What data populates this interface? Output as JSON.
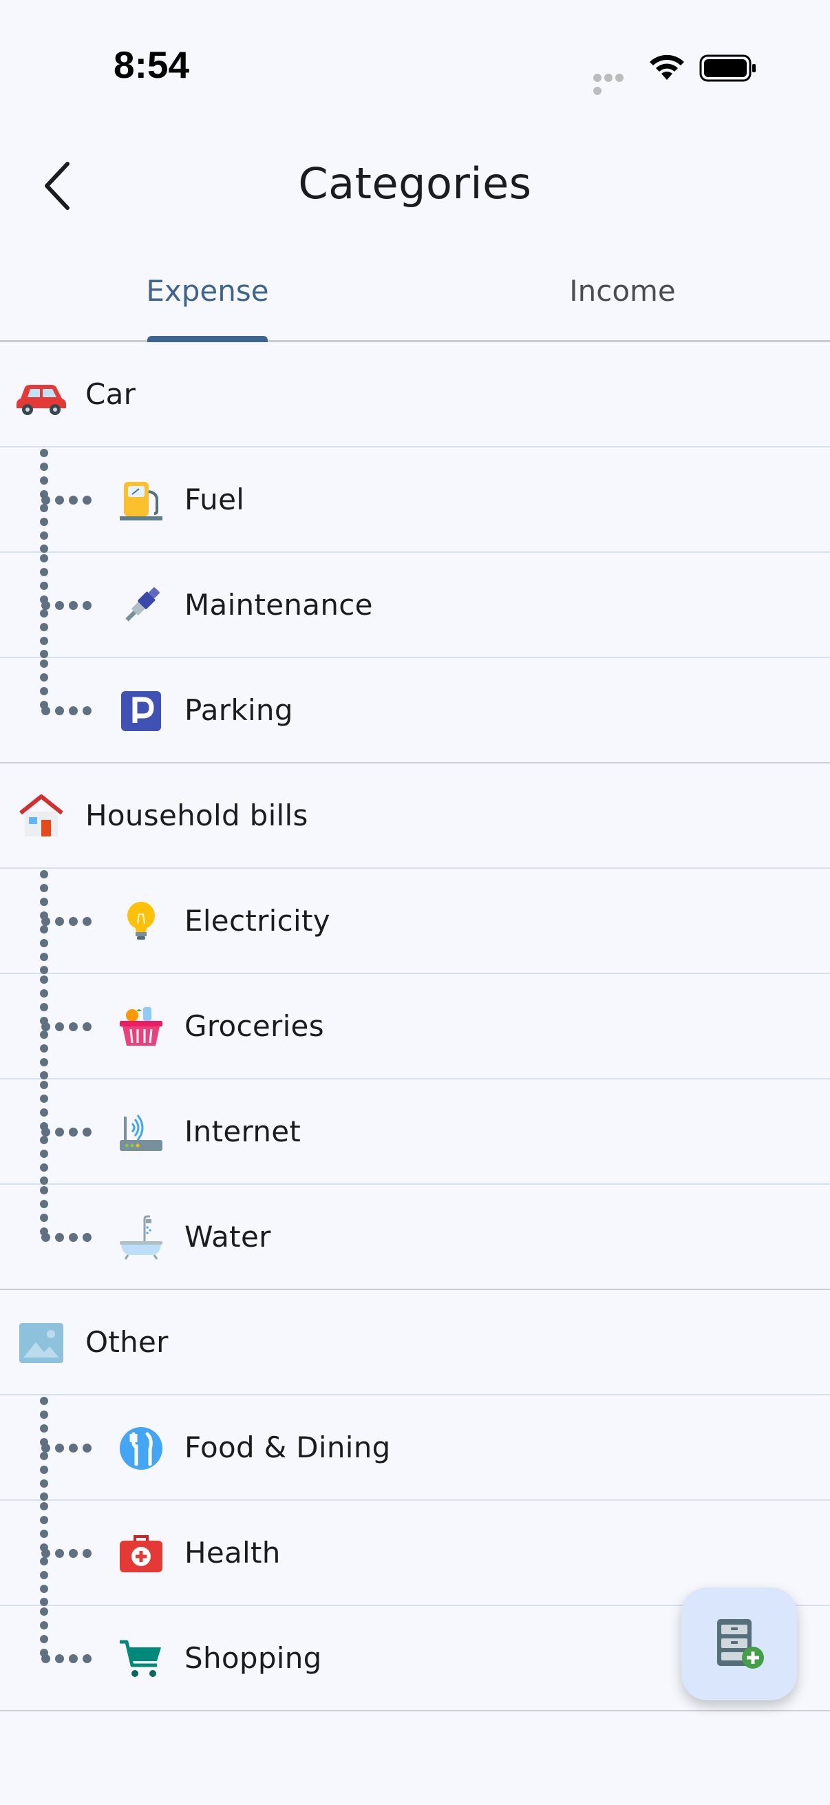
{
  "status_bar": {
    "time": "8:54"
  },
  "header": {
    "title": "Categories"
  },
  "tabs": [
    {
      "label": "Expense",
      "active": true
    },
    {
      "label": "Income",
      "active": false
    }
  ],
  "groups": [
    {
      "label": "Car",
      "icon": "car-icon",
      "children": [
        {
          "label": "Fuel",
          "icon": "fuel-pump-icon"
        },
        {
          "label": "Maintenance",
          "icon": "spark-plug-icon"
        },
        {
          "label": "Parking",
          "icon": "parking-icon"
        }
      ]
    },
    {
      "label": "Household bills",
      "icon": "house-icon",
      "children": [
        {
          "label": "Electricity",
          "icon": "light-bulb-icon"
        },
        {
          "label": "Groceries",
          "icon": "shopping-basket-icon"
        },
        {
          "label": "Internet",
          "icon": "router-icon"
        },
        {
          "label": "Water",
          "icon": "bathtub-icon"
        }
      ]
    },
    {
      "label": "Other",
      "icon": "picture-icon",
      "children": [
        {
          "label": "Food & Dining",
          "icon": "fork-knife-icon"
        },
        {
          "label": "Health",
          "icon": "medical-kit-icon"
        },
        {
          "label": "Shopping",
          "icon": "shopping-cart-icon"
        }
      ]
    }
  ],
  "fab": {
    "icon": "add-category-icon"
  },
  "colors": {
    "accent": "#3d6590",
    "background": "#f6f8fd",
    "fab": "#d9e6fb",
    "tree_dots": "#5f7180"
  }
}
